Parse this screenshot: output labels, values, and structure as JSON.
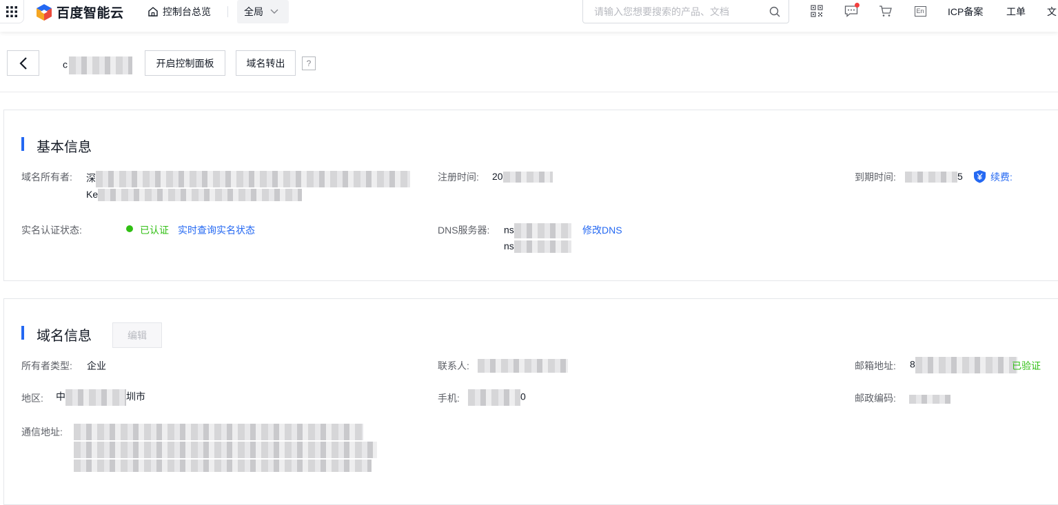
{
  "topbar": {
    "brand": "百度智能云",
    "home_label": "控制台总览",
    "region_label": "全局",
    "search_placeholder": "请输入您想要搜索的产品、文档",
    "lang_label": "En",
    "icp_label": "ICP备案",
    "ticket_label": "工单",
    "doc_label": "文"
  },
  "header": {
    "domain_prefix": "c",
    "open_panel_label": "开启控制面板",
    "transfer_label": "域名转出",
    "help_label": "?"
  },
  "basic_info": {
    "title": "基本信息",
    "owner_label": "域名所有者:",
    "owner_line1_prefix": "深",
    "owner_line2_prefix": "Ke",
    "reg_time_label": "注册时间:",
    "reg_time_prefix": "20",
    "expire_label": "到期时间:",
    "expire_suffix": "5",
    "renew_label": "续费:",
    "renew_icon": "yen-shield-icon",
    "realname_label": "实名认证状态:",
    "realname_status": "已认证",
    "realname_query_label": "实时查询实名状态",
    "dns_label": "DNS服务器:",
    "dns_servers": [
      "ns",
      "ns"
    ],
    "dns_modify_label": "修改DNS"
  },
  "domain_info": {
    "title": "域名信息",
    "edit_label": "编辑",
    "owner_type_label": "所有者类型:",
    "owner_type_value": "企业",
    "contact_label": "联系人:",
    "email_label": "邮箱地址:",
    "email_prefix": "8",
    "email_verify_label": "已验证",
    "region_label": "地区:",
    "region_prefix": "中",
    "region_suffix": "圳市",
    "phone_label": "手机:",
    "phone_suffix": "0",
    "zip_label": "邮政编码:",
    "address_label": "通信地址:"
  },
  "colors": {
    "accent": "#2468f2",
    "success": "#30bf13",
    "alert_dot": "#f33e3e"
  }
}
